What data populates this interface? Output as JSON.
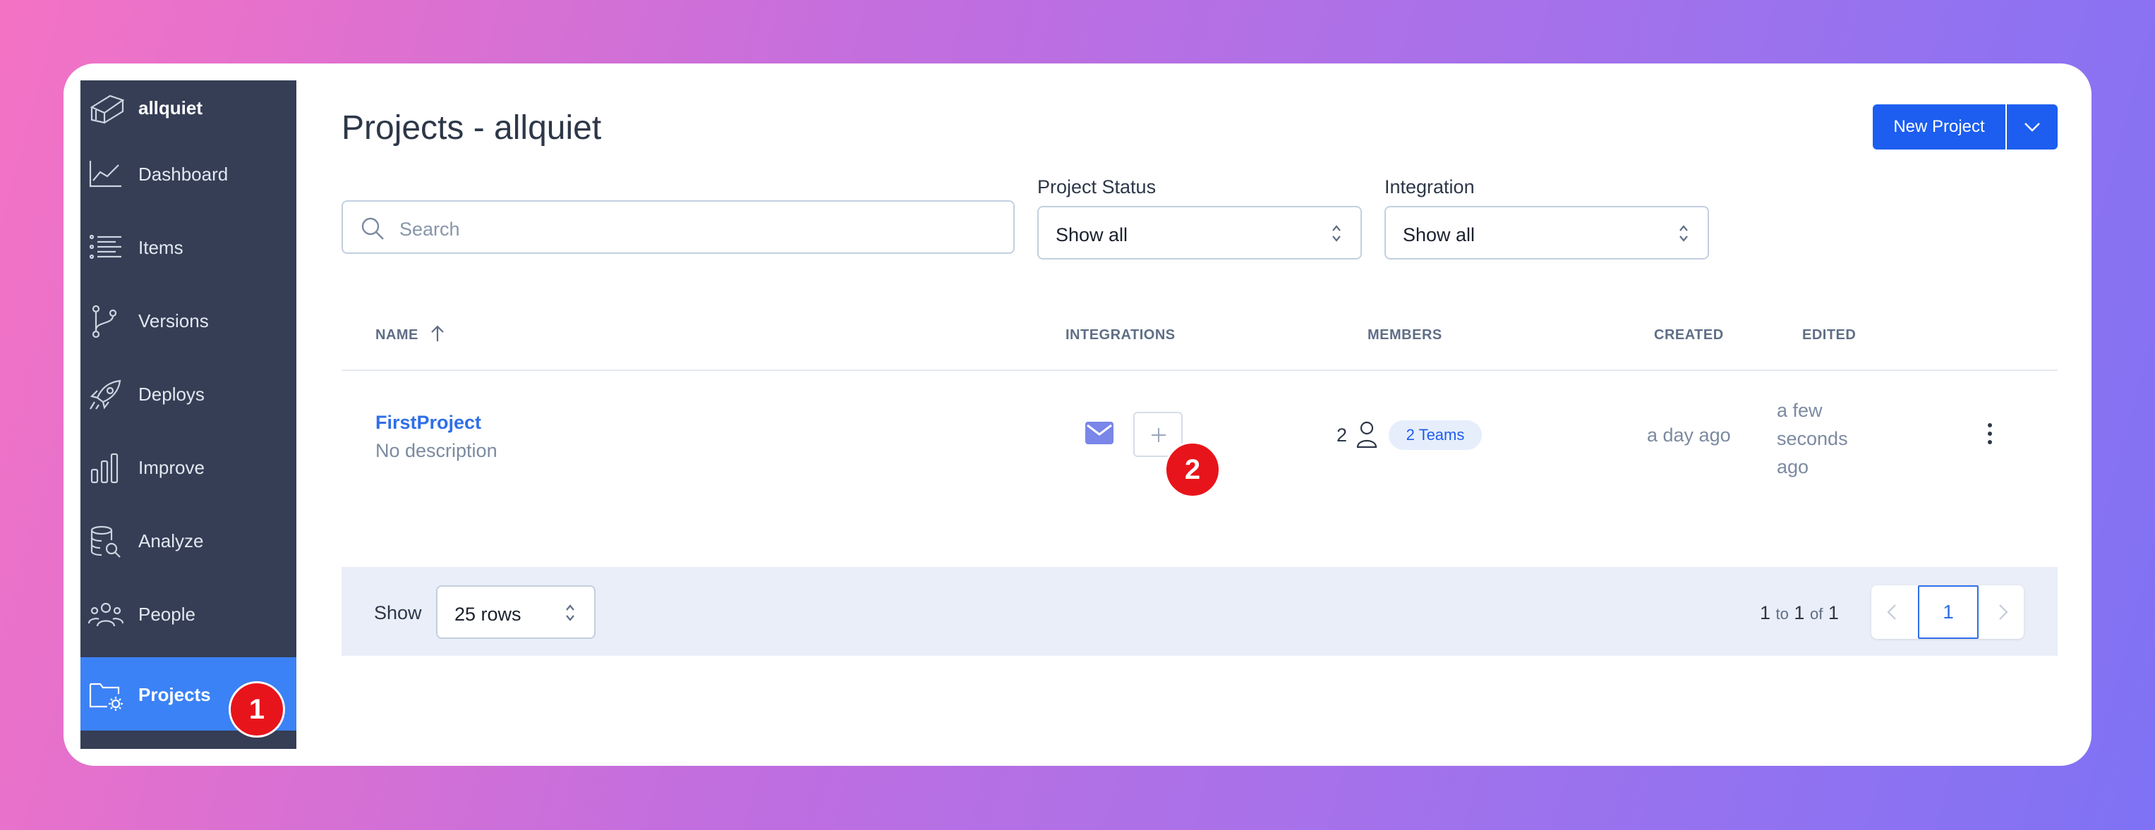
{
  "sidebar": {
    "brand": "allquiet",
    "items": [
      {
        "label": "Dashboard",
        "icon": "chart-line-icon"
      },
      {
        "label": "Items",
        "icon": "list-icon"
      },
      {
        "label": "Versions",
        "icon": "git-branch-icon"
      },
      {
        "label": "Deploys",
        "icon": "rocket-icon"
      },
      {
        "label": "Improve",
        "icon": "bar-chart-icon"
      },
      {
        "label": "Analyze",
        "icon": "database-search-icon"
      },
      {
        "label": "People",
        "icon": "people-icon"
      },
      {
        "label": "Projects",
        "icon": "folder-gear-icon",
        "active": true
      }
    ]
  },
  "annotations": {
    "step1": "1",
    "step2": "2"
  },
  "header": {
    "title": "Projects - allquiet",
    "new_project_label": "New Project"
  },
  "filters": {
    "search_placeholder": "Search",
    "project_status_label": "Project Status",
    "project_status_value": "Show all",
    "integration_label": "Integration",
    "integration_value": "Show all"
  },
  "table": {
    "columns": [
      "NAME",
      "INTEGRATIONS",
      "MEMBERS",
      "CREATED",
      "EDITED"
    ],
    "rows": [
      {
        "name": "FirstProject",
        "description": "No description",
        "integrations": [
          "mail-icon"
        ],
        "member_count": "2",
        "teams": "2 Teams",
        "created": "a day ago",
        "edited": "a few seconds ago"
      }
    ]
  },
  "footer": {
    "show_label": "Show",
    "rows_value": "25 rows",
    "range_start": "1",
    "range_to": "to",
    "range_end": "1",
    "range_of": "of",
    "range_total": "1",
    "current_page": "1"
  },
  "colors": {
    "sidebar_bg": "#353e55",
    "accent": "#1d5ef0",
    "active_nav": "#3b82f6",
    "annotation_badge": "#e8141b"
  }
}
